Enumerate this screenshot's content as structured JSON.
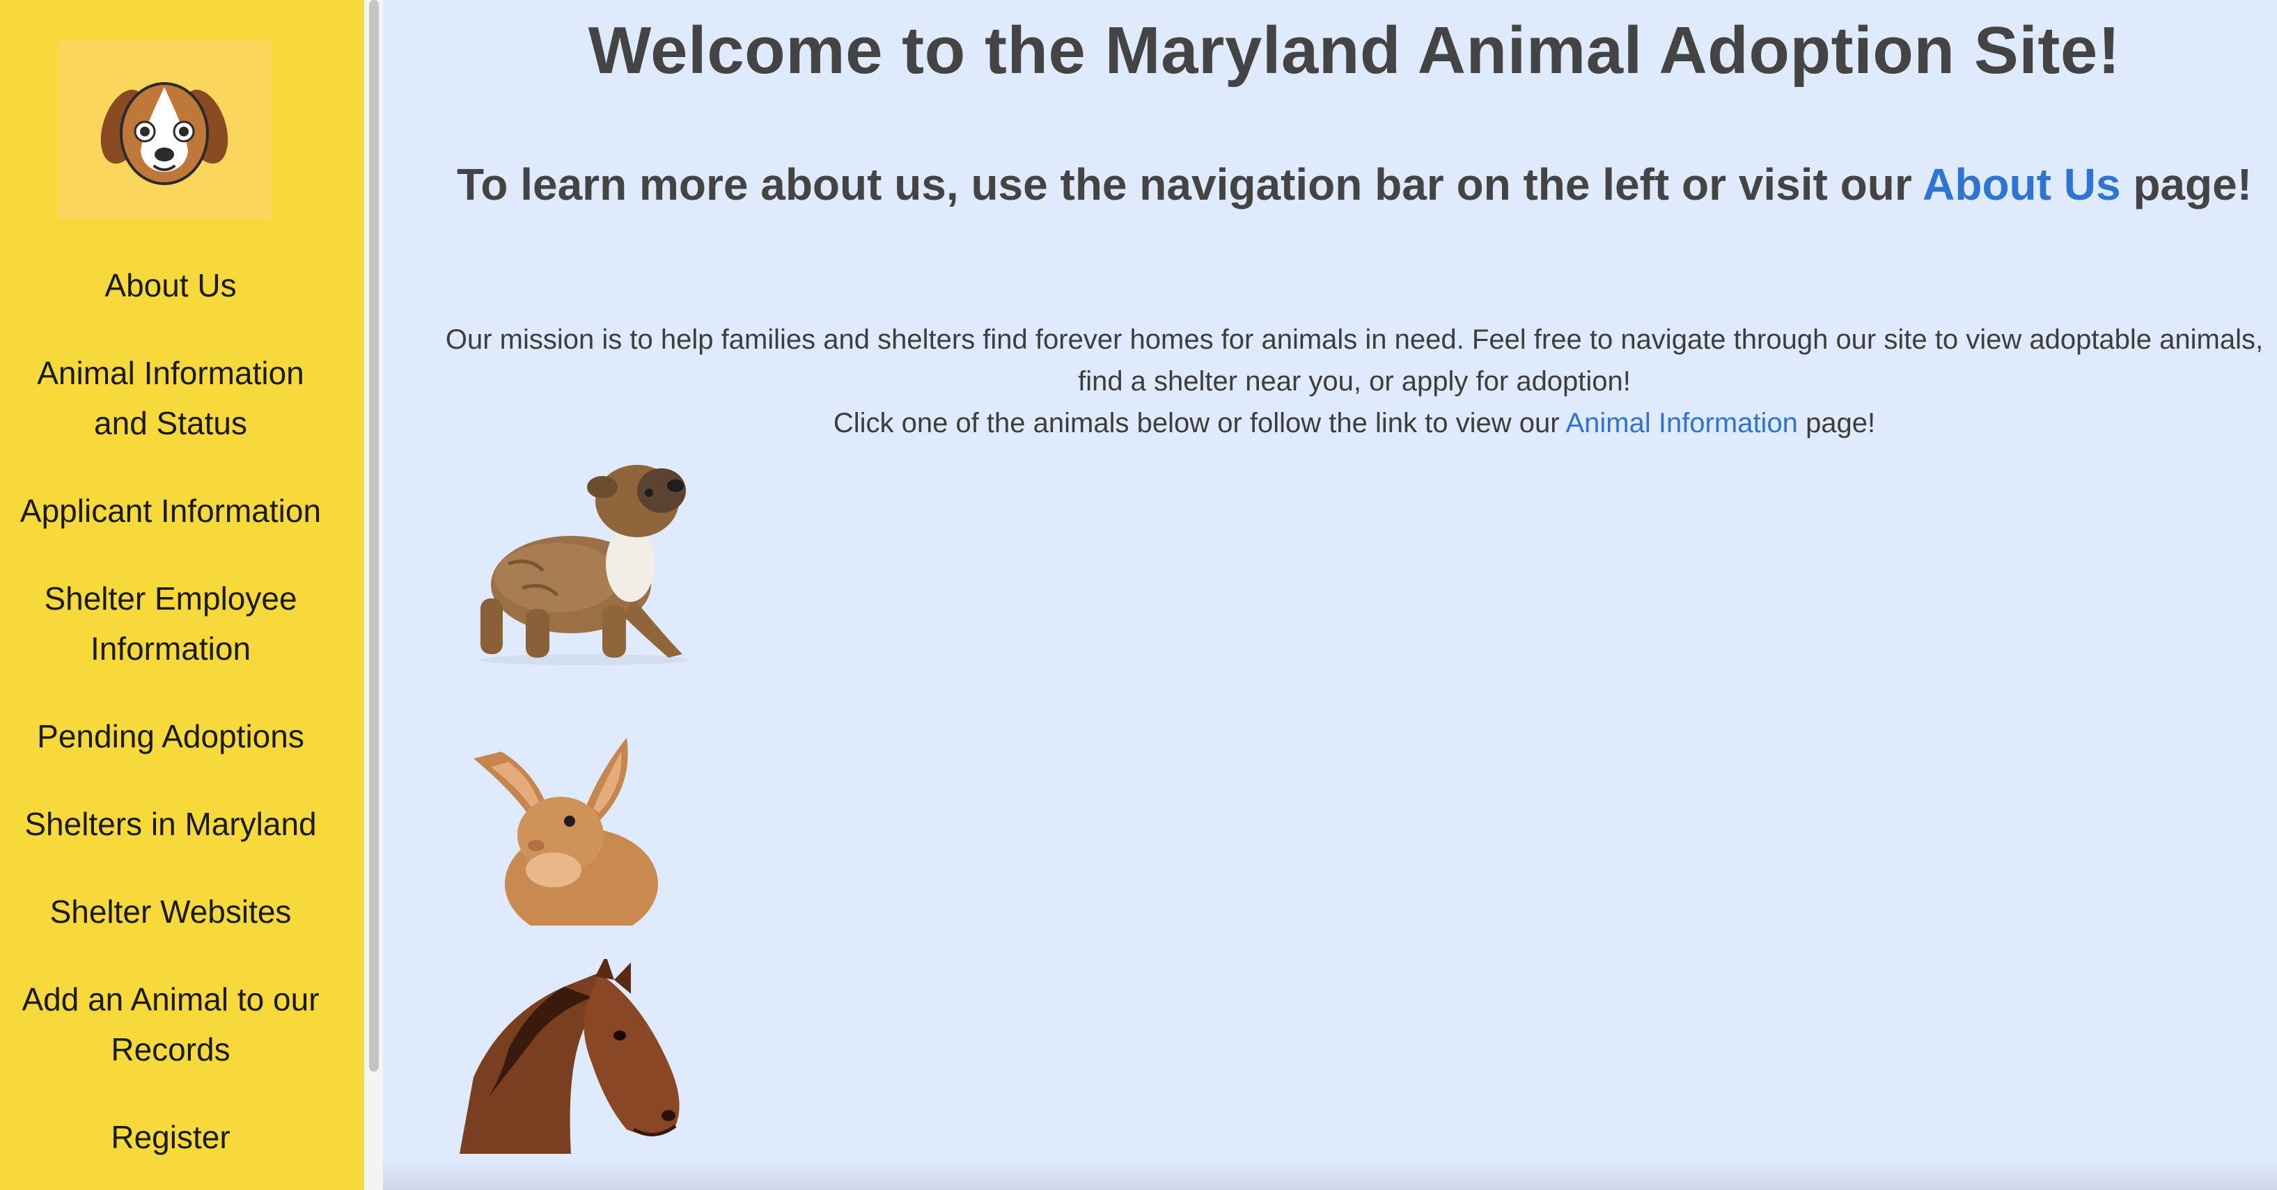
{
  "sidebar": {
    "logo_icon": "dog-face-icon",
    "items": [
      {
        "label": "About Us"
      },
      {
        "label": "Animal Information and Status"
      },
      {
        "label": "Applicant Information"
      },
      {
        "label": "Shelter Employee Information"
      },
      {
        "label": "Pending Adoptions"
      },
      {
        "label": "Shelters in Maryland"
      },
      {
        "label": "Shelter Websites"
      },
      {
        "label": "Add an Animal to our Records"
      },
      {
        "label": "Register"
      }
    ]
  },
  "main": {
    "title": "Welcome to the Maryland Animal Adoption Site!",
    "subtitle_prefix": "To learn more about us, use the navigation bar on the left or visit our",
    "subtitle_link": "About Us",
    "subtitle_suffix": "page!",
    "mission_text": "Our mission is to help families and shelters find forever homes for animals in need. Feel free to navigate through our site to view adoptable animals, find a shelter near you, or apply for adoption!",
    "click_prefix": "Click one of the animals below or follow the link to view our",
    "click_link": "Animal Information",
    "click_suffix": "page!",
    "animals": [
      {
        "name": "puppy"
      },
      {
        "name": "rabbit"
      },
      {
        "name": "horse"
      }
    ]
  },
  "colors": {
    "sidebar_bg": "#f8d93c",
    "page_bg": "#dfeafc",
    "link": "#2f74d0",
    "heading": "#444444"
  }
}
